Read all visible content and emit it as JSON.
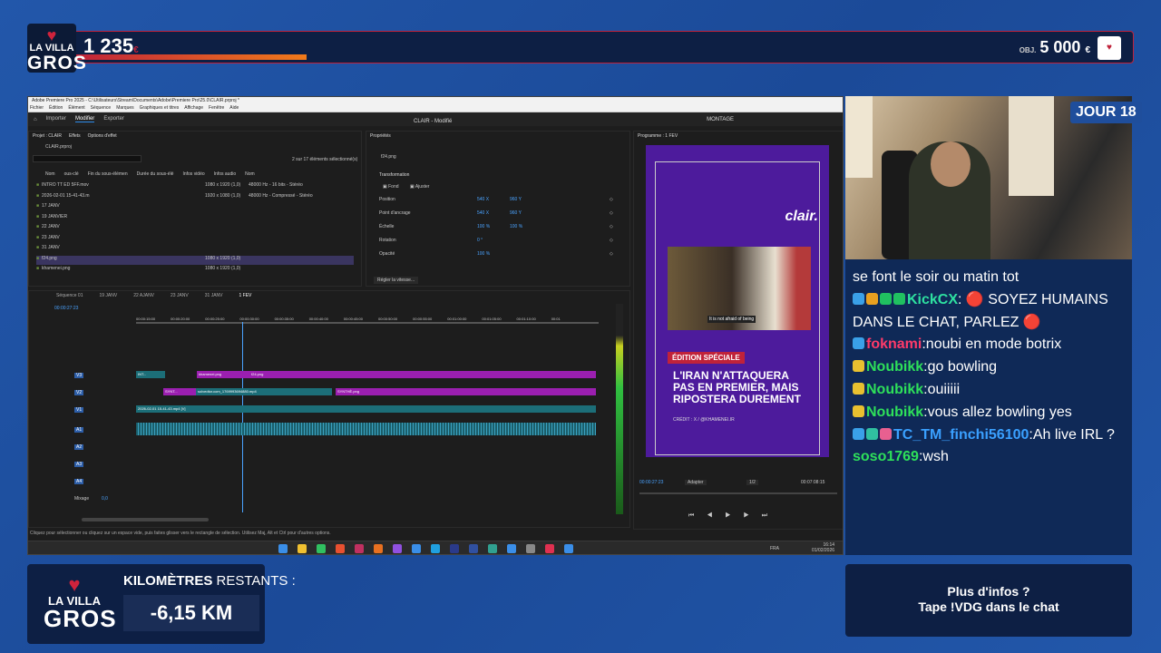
{
  "overlay": {
    "logo_line1": "LA VILLA",
    "logo_line2": "GROS",
    "counter_value": "1 235",
    "counter_unit": "€",
    "goal_prefix": "OBJ.",
    "goal_value": "5 000",
    "goal_unit": "€",
    "progress_fraction": 0.22,
    "day_badge": "JOUR 18",
    "km_label_bold": "KILOMÈTRES",
    "km_label_rest": "RESTANTS :",
    "km_value": "-6,15 KM",
    "info_line1": "Plus d'infos ?",
    "info_line2": "Tape !VDG dans le chat"
  },
  "premiere": {
    "window_title": "Adobe Premiere Pro 2025 - C:\\Utilisateurs\\Stream\\Documents\\Adobe\\Premiere Pro\\25.0\\CLAIR.prproj *",
    "menu": [
      "Fichier",
      "Édition",
      "Élément",
      "Séquence",
      "Marques",
      "Graphiques et titres",
      "Affichage",
      "Fenêtre",
      "Aide"
    ],
    "header_tabs": [
      "Importer",
      "Modifier",
      "Exporter"
    ],
    "active_tab": "Modifier",
    "project_title": "CLAIR - Modifié",
    "montage_label": "MONTAGE",
    "project_panel": {
      "tabs": [
        "Projet : CLAIR",
        "Effets",
        "Options d'effet"
      ],
      "file": "CLAIR.prproj",
      "selection_info": "2 sur 17 éléments sélectionné(s)",
      "columns": [
        "Nom",
        "ous-clé",
        "Fin du sous-élémen",
        "Durée du sous-élé",
        "Infos vidéo",
        "Infos audio",
        "Nom"
      ],
      "items": [
        {
          "name": "INTRO TT ED 5FF.mov",
          "video": "1080 x 1920 (1,0)",
          "audio": "48000 Hz - 16 bits - Stéréo"
        },
        {
          "name": "2026-02-01 15-41-43.m",
          "video": "1920 x 1080 (1,0)",
          "audio": "48000 Hz - Compressé - Stéréo"
        },
        {
          "name": "17 JANV",
          "video": "",
          "audio": ""
        },
        {
          "name": "19 JANVIER",
          "video": "",
          "audio": ""
        },
        {
          "name": "22 JANV",
          "video": "",
          "audio": ""
        },
        {
          "name": "23 JANV",
          "video": "",
          "audio": ""
        },
        {
          "name": "31 JANV",
          "video": "",
          "audio": ""
        },
        {
          "name": "f24.png",
          "video": "1080 x 1920 (1,0)",
          "audio": ""
        },
        {
          "name": "khamenei.png",
          "video": "1080 x 1920 (1,0)",
          "audio": ""
        }
      ]
    },
    "properties": {
      "tab": "Propriétés",
      "file": "f24.png",
      "section": "Transformation",
      "fond_label": "Fond",
      "ajuster_label": "Ajuster",
      "rows": [
        {
          "label": "Position",
          "v1": "540 X",
          "v2": "960 Y"
        },
        {
          "label": "Point d'ancrage",
          "v1": "540 X",
          "v2": "960 Y"
        },
        {
          "label": "Échelle",
          "v1": "100 %",
          "v2": "100 %"
        },
        {
          "label": "Rotation",
          "v1": "0 °",
          "v2": ""
        },
        {
          "label": "Opacité",
          "v1": "100 %",
          "v2": ""
        }
      ],
      "speed_button": "Régler la vitesse..."
    },
    "program": {
      "tab": "Programme : 1 FEV",
      "timecode": "00:00:27:23",
      "fit": "Adapter",
      "ratio": "1/2",
      "duration": "00:07:08:15"
    },
    "video_frame": {
      "brand": "clair.",
      "photo_caption": "It is not afraid of being",
      "badge": "ÉDITION SPÉCIALE",
      "headline": "L'IRAN N'ATTAQUERA PAS EN PREMIER, MAIS RIPOSTERA DUREMENT",
      "credit": "CRÉDIT : X / @KHAMENEI.IR"
    },
    "timeline": {
      "tabs": [
        "Séquence 01",
        "19 JANV",
        "22 AJANV",
        "23 JANV",
        "31 JANV",
        "1 FEV"
      ],
      "timecode": "00:00:27:23",
      "ruler": [
        "00:00:15:00",
        "00:00:20:00",
        "00:00:25:00",
        "00:00:30:00",
        "00:00:35:00",
        "00:00:40:00",
        "00:00:45:00",
        "00:00:50:00",
        "00:00:55:00",
        "00:01:00:00",
        "00:01:05:00",
        "00:01:10:00",
        "00:01"
      ],
      "tracks": [
        "V3",
        "V2",
        "V1",
        "A1",
        "A2",
        "A3",
        "A4",
        "Mixage"
      ],
      "mix_value": "0,0",
      "clips": {
        "v3": [
          "INT...",
          "khamenei.png",
          "f24.png"
        ],
        "v2": [
          "SYNT...",
          "solvedtor.com_1769993694880.mp4",
          "SYNTHÈ.png"
        ],
        "v1": [
          "2026-02-01 15-41-43.mp4 [V]"
        ]
      }
    },
    "status_bar": "Cliquez pour sélectionner ou cliquez sur un espace vide, puis faites glisser vers le rectangle de sélection. Utilisez Maj, Alt et Ctrl pour d'autres options.",
    "taskbar": {
      "lang": "FRA",
      "time": "16:14",
      "date": "01/02/2026"
    }
  },
  "chat": [
    {
      "user": "",
      "color": "#ffffff",
      "msg": "se font le soir ou matin tot",
      "icons": []
    },
    {
      "user": "KickCX",
      "color": "#2ee0a0",
      "msg": ": 🔴 SOYEZ HUMAINS DANS LE CHAT, PARLEZ 🔴",
      "icons": [
        "#3aa0e8",
        "#e8a020",
        "#20c060",
        "#20c060"
      ]
    },
    {
      "user": "foknami",
      "color": "#ff3a6a",
      "msg": ":noubi en mode botrix",
      "icons": [
        "#3aa0e8"
      ]
    },
    {
      "user": "Noubikk",
      "color": "#2ee05a",
      "msg": ":go bowling",
      "icons": [
        "#e8c030"
      ]
    },
    {
      "user": "Noubikk",
      "color": "#2ee05a",
      "msg": ":ouiiiii",
      "icons": [
        "#e8c030"
      ]
    },
    {
      "user": "Noubikk",
      "color": "#2ee05a",
      "msg": ":vous allez bowling yes",
      "icons": [
        "#e8c030"
      ]
    },
    {
      "user": "TC_TM_finchi56100",
      "color": "#3aa0ff",
      "msg": ":Ah live IRL ?",
      "icons": [
        "#3aa0e8",
        "#30c0a0",
        "#e86090"
      ]
    },
    {
      "user": "soso1769",
      "color": "#2ee05a",
      "msg": ":wsh",
      "icons": []
    }
  ]
}
